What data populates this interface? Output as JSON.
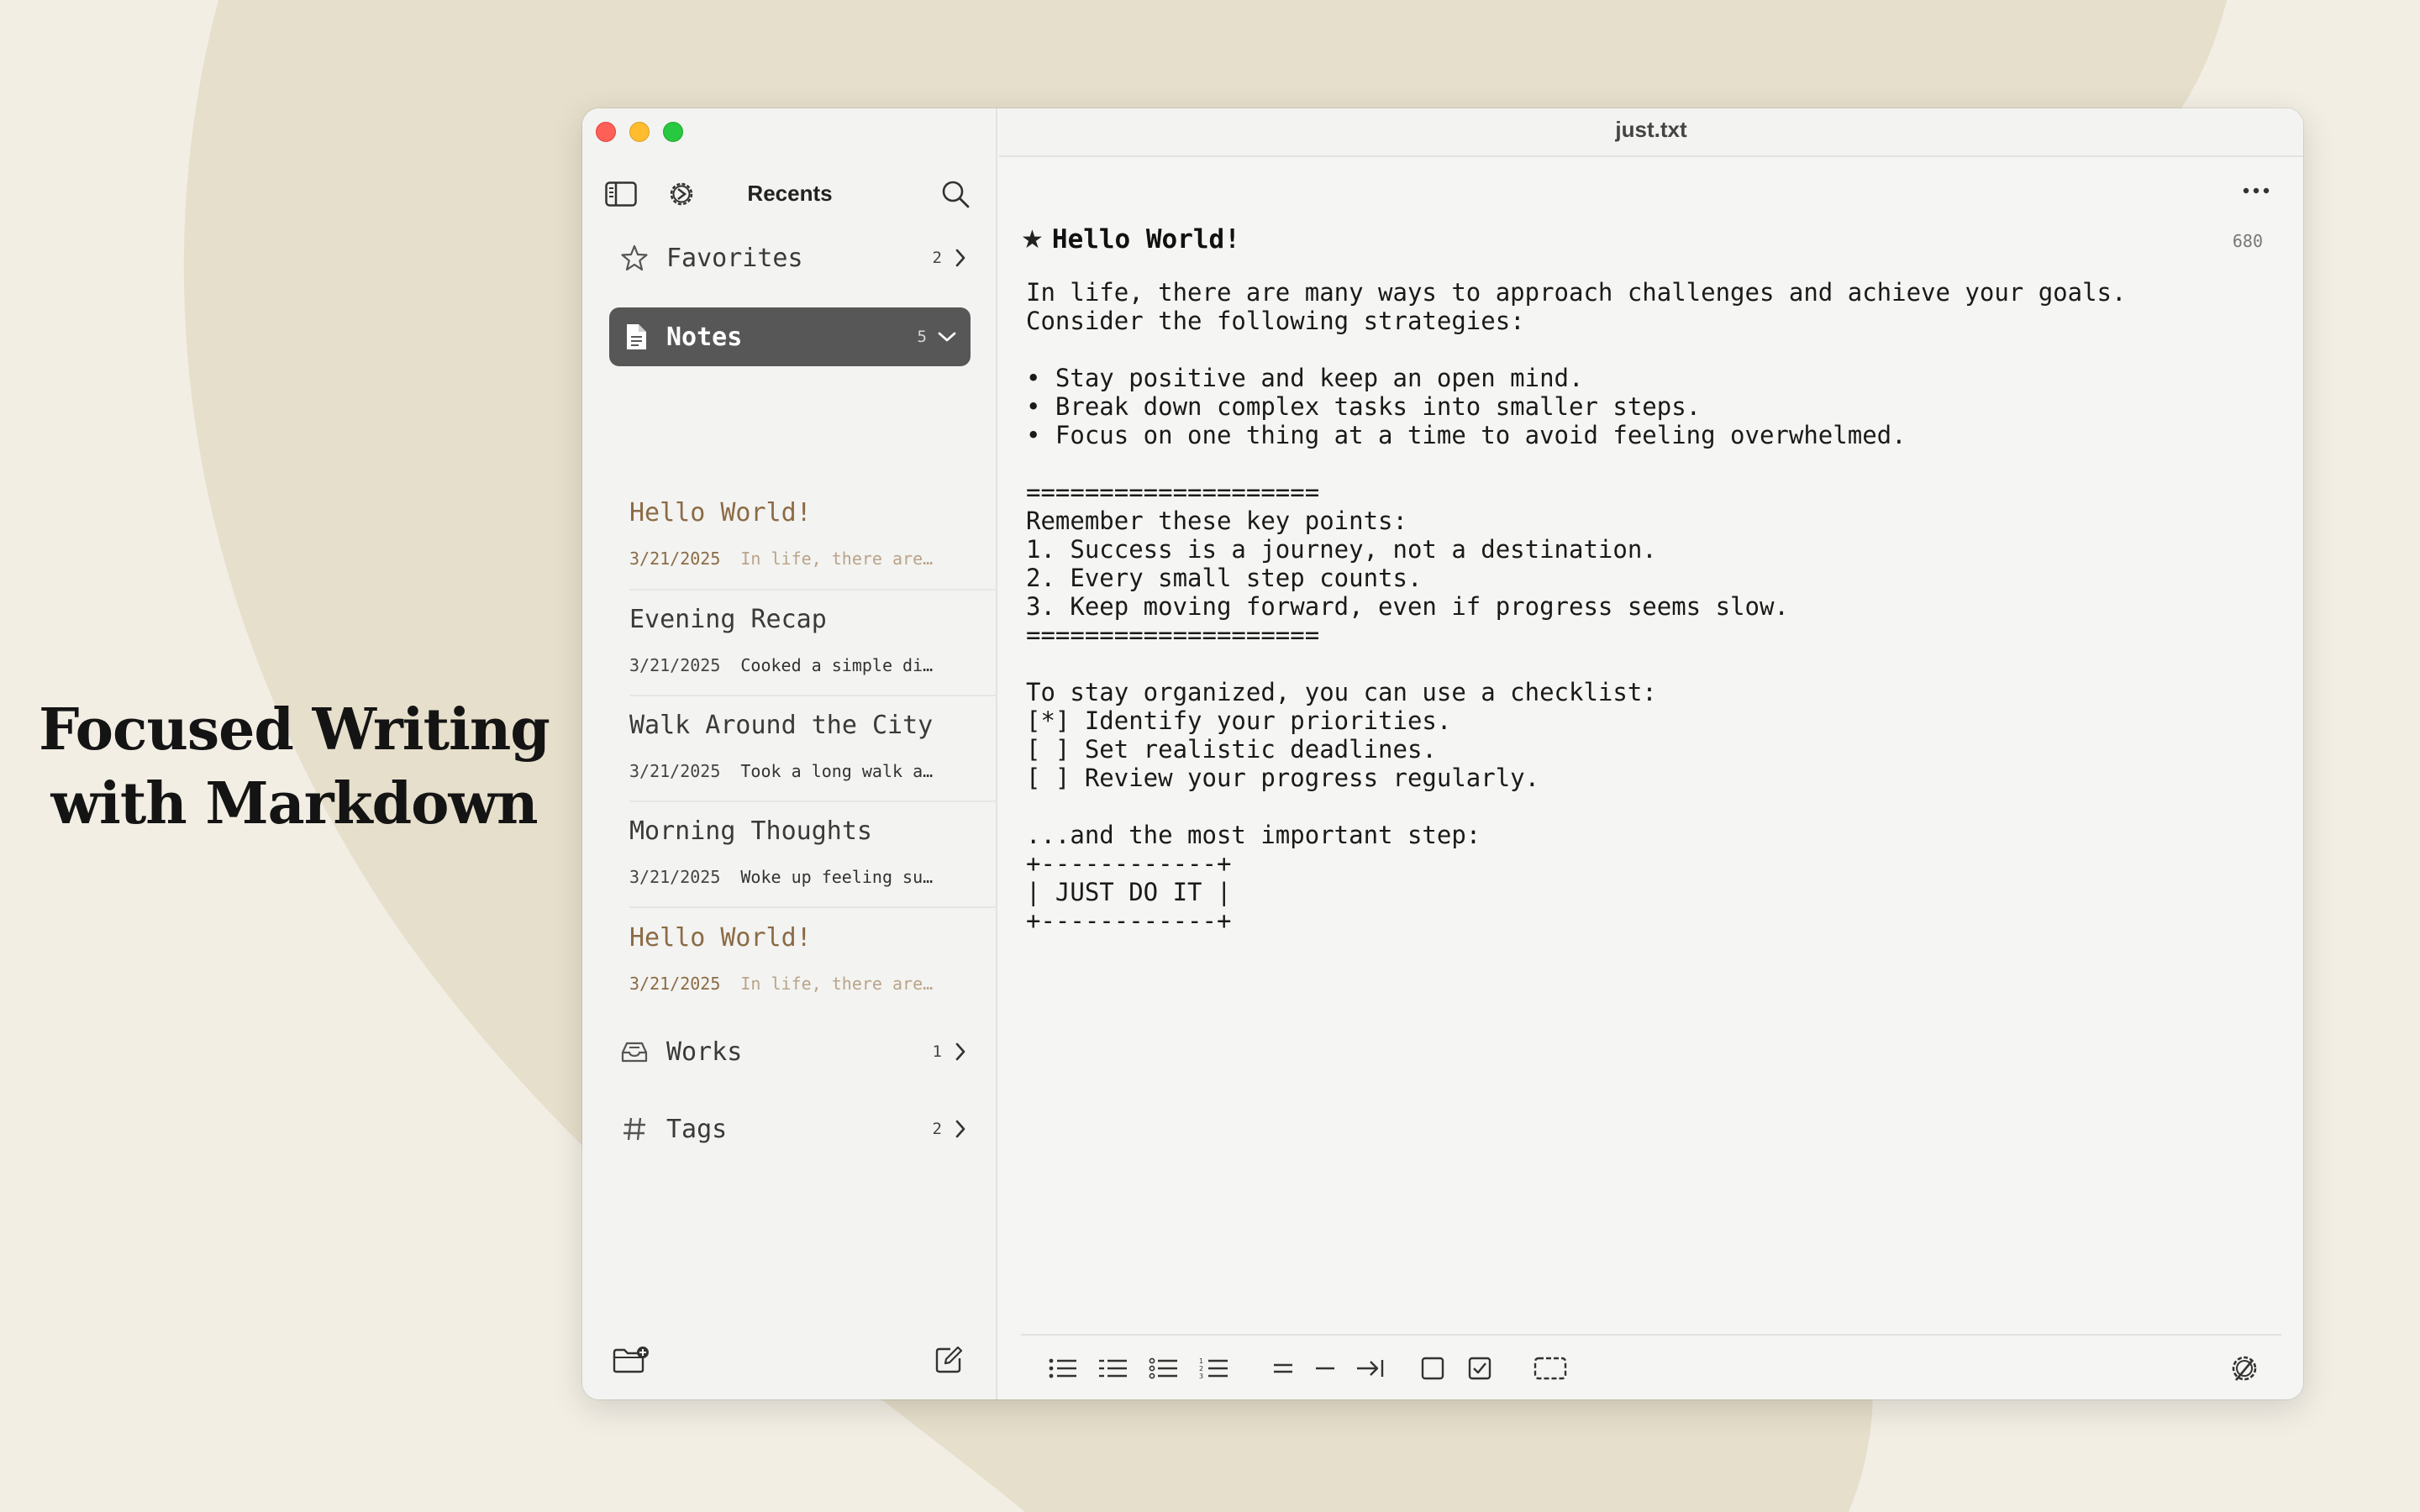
{
  "headline": {
    "line1": "Focused Writing",
    "line2": "with Markdown"
  },
  "window": {
    "file_name": "just.txt"
  },
  "sidebar": {
    "title": "Recents",
    "sections": {
      "favorites": {
        "label": "Favorites",
        "count": "2"
      },
      "notes": {
        "label": "Notes",
        "count": "5"
      },
      "works": {
        "label": "Works",
        "count": "1"
      },
      "tags": {
        "label": "Tags",
        "count": "2"
      }
    },
    "notes": [
      {
        "title": "Hello World!",
        "date": "3/21/2025",
        "snippet": "In life, there are…"
      },
      {
        "title": "Evening Recap",
        "date": "3/21/2025",
        "snippet": "Cooked a simple di…"
      },
      {
        "title": "Walk Around the City",
        "date": "3/21/2025",
        "snippet": "Took a long walk a…"
      },
      {
        "title": "Morning Thoughts",
        "date": "3/21/2025",
        "snippet": "Woke up feeling su…"
      },
      {
        "title": "Hello World!",
        "date": "3/21/2025",
        "snippet": "In life, there are…"
      }
    ]
  },
  "editor": {
    "title": "Hello World!",
    "word_count": "680",
    "body": "In life, there are many ways to approach challenges and achieve your goals.\nConsider the following strategies:\n\n• Stay positive and keep an open mind.\n• Break down complex tasks into smaller steps.\n• Focus on one thing at a time to avoid feeling overwhelmed.\n\n====================\nRemember these key points:\n1. Success is a journey, not a destination.\n2. Every small step counts.\n3. Keep moving forward, even if progress seems slow.\n====================\n\nTo stay organized, you can use a checklist:\n[*] Identify your priorities.\n[ ] Set realistic deadlines.\n[ ] Review your progress regularly.\n\n...and the most important step:\n+------------+\n| JUST DO IT |\n+------------+"
  },
  "colors": {
    "background": "#f2eee4",
    "accent_shape": "#e6dfcb",
    "active_section": "#575757",
    "highlight_note": "#8b6b45"
  }
}
